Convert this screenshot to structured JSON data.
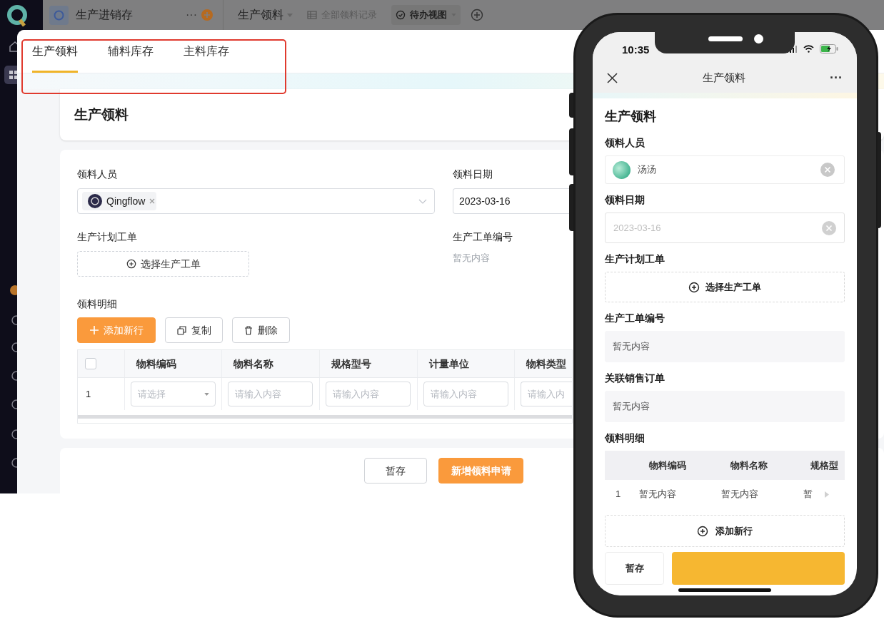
{
  "app_bar": {
    "app_name": "生产进销存",
    "more": "···",
    "current_form": "生产领料",
    "views": [
      {
        "label": "全部领料记录",
        "selected": false
      },
      {
        "label": "待办视图",
        "selected": true
      }
    ]
  },
  "tabs": [
    {
      "label": "生产领料",
      "selected": true
    },
    {
      "label": "辅料库存",
      "selected": false
    },
    {
      "label": "主料库存",
      "selected": false
    }
  ],
  "form": {
    "title": "生产领料",
    "fields": [
      {
        "kind": "member",
        "label": "领料人员",
        "value": "Qingflow"
      },
      {
        "kind": "date",
        "label": "领料日期",
        "value": "2023-03-16"
      },
      {
        "kind": "picker",
        "label": "生产计划工单",
        "button": "选择生产工单"
      },
      {
        "kind": "readonly",
        "label": "生产工单编号",
        "value": "暂无内容"
      }
    ],
    "detail": {
      "label": "领料明细",
      "actions": [
        {
          "kind": "add",
          "label": "添加新行"
        },
        {
          "kind": "copy",
          "label": "复制"
        },
        {
          "kind": "delete",
          "label": "删除"
        }
      ],
      "select_all_checked": false,
      "columns": [
        "物料编码",
        "物料名称",
        "规格型号",
        "计量单位",
        "物料类型"
      ],
      "rows": [
        {
          "index": "1",
          "cells": [
            {
              "kind": "select",
              "placeholder": "请选择"
            },
            {
              "kind": "text",
              "placeholder": "请输入内容"
            },
            {
              "kind": "text",
              "placeholder": "请输入内容"
            },
            {
              "kind": "text",
              "placeholder": "请输入内容"
            },
            {
              "kind": "text",
              "placeholder": "请输入内"
            }
          ]
        }
      ]
    },
    "buttons": [
      {
        "kind": "secondary",
        "label": "暂存"
      },
      {
        "kind": "primary",
        "label": "新增领料申请"
      }
    ]
  },
  "phone": {
    "time": "10:35",
    "nav_title": "生产领料",
    "more": "···",
    "form_title": "生产领料",
    "fields": [
      {
        "kind": "member",
        "label": "领料人员",
        "value": "汤汤"
      },
      {
        "kind": "date",
        "label": "领料日期",
        "value": "2023-03-16",
        "disabled": true
      },
      {
        "kind": "picker",
        "label": "生产计划工单",
        "button": "选择生产工单"
      },
      {
        "kind": "readonly",
        "label": "生产工单编号",
        "value": "暂无内容"
      },
      {
        "kind": "readonly",
        "label": "关联销售订单",
        "value": "暂无内容"
      },
      {
        "kind": "table",
        "label": "领料明细",
        "columns": [
          "物料编码",
          "物料名称",
          "规格型"
        ],
        "rows": [
          {
            "index": "1",
            "cells": [
              "暂无内容",
              "暂无内容",
              "暂"
            ]
          }
        ],
        "add_button": "添加新行"
      }
    ],
    "buttons": [
      {
        "kind": "secondary",
        "label": "暂存"
      },
      {
        "kind": "primary"
      }
    ]
  }
}
